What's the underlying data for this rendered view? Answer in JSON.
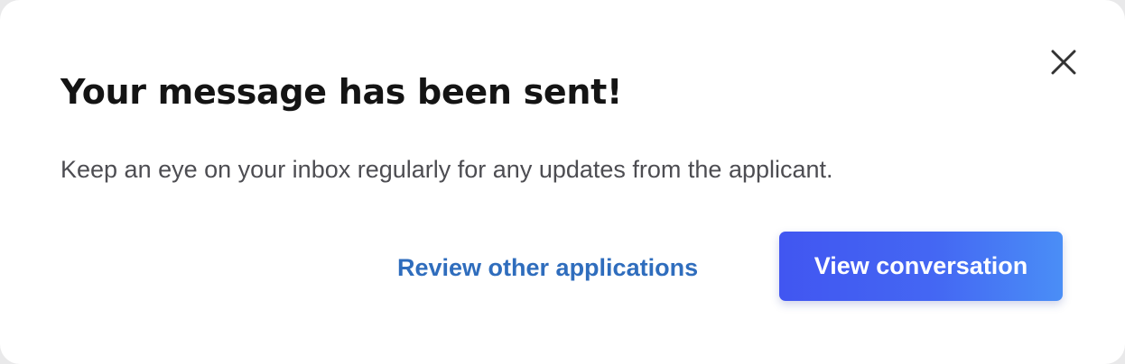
{
  "dialog": {
    "title": "Your message has been sent!",
    "message": "Keep an eye on your inbox regularly for any updates from the applicant.",
    "close_icon": "close-icon",
    "secondary_action_label": "Review other applications",
    "primary_action_label": "View conversation"
  },
  "colors": {
    "title": "#141414",
    "body_text": "#4d4d52",
    "link": "#2f6dbd",
    "primary_gradient_start": "#4156f1",
    "primary_gradient_end": "#4a8ef6",
    "primary_text": "#ffffff",
    "close_icon": "#333333"
  }
}
